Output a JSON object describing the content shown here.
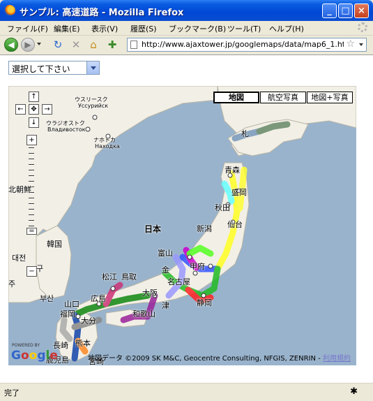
{
  "window": {
    "title": "サンプル: 高速道路 - Mozilla Firefox",
    "minimize": "_",
    "maximize": "□",
    "close": "×"
  },
  "menu": [
    "ファイル(F)",
    "編集(E)",
    "表示(V)",
    "履歴(S)",
    "ブックマーク(B)",
    "ツール(T)",
    "ヘルプ(H)"
  ],
  "nav": {
    "url": "http://www.ajaxtower.jp/googlemaps/data/map6_1.ht"
  },
  "page": {
    "select_value": "選択して下さい"
  },
  "map": {
    "types": [
      "地図",
      "航空写真",
      "地図+写真"
    ],
    "active_type": "地図",
    "copyright": "地図データ ©2009 SK M&C, Geocentre Consulting, NFGIS, ZENRIN -",
    "terms": "利用規約",
    "powered": "POWERED BY",
    "google": "Google",
    "labels": {
      "vladivostok_kana": "ウラジオストク",
      "vladivostok_ru": "Владивосток",
      "ussuriysk_kana": "ウスリースク",
      "ussuriysk_ru": "Уссурийск",
      "nakhodka_kana": "ナホトカ",
      "nakhodka_ru": "Находка",
      "japan": "日本",
      "aomori": "青森",
      "morioka": "盛岡",
      "akita": "秋田",
      "niigata": "新潟",
      "sendai": "仙台",
      "toyama": "富山",
      "kanazawa": "金",
      "kofu": "甲府",
      "nagoya": "名古屋",
      "shizuoka": "静岡",
      "tsu": "津",
      "osaka": "大阪",
      "wakayama": "和歌山",
      "matsue": "松江",
      "tottori": "鳥取",
      "hiroshima": "広島",
      "yamaguchi": "山口",
      "fukuoka": "福岡",
      "oita": "大分",
      "kumamoto": "熊本",
      "nagasaki": "長崎",
      "kagoshima": "鹿児島",
      "miyazaki": "宮崎",
      "kita_chosen": "北朝鮮",
      "kankoku": "韓国",
      "daejeon": "대전",
      "busan": "부산",
      "gu": "구",
      "ju": "주",
      "sapporo": "札"
    }
  },
  "status": {
    "text": "完了"
  }
}
